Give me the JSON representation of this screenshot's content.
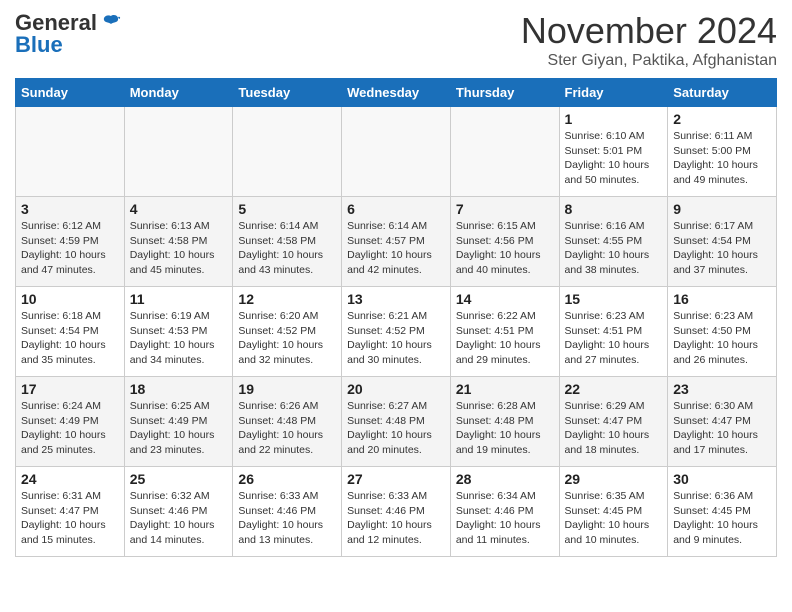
{
  "header": {
    "logo_general": "General",
    "logo_blue": "Blue",
    "month_title": "November 2024",
    "subtitle": "Ster Giyan, Paktika, Afghanistan"
  },
  "calendar": {
    "days_of_week": [
      "Sunday",
      "Monday",
      "Tuesday",
      "Wednesday",
      "Thursday",
      "Friday",
      "Saturday"
    ],
    "weeks": [
      [
        {
          "day": "",
          "info": ""
        },
        {
          "day": "",
          "info": ""
        },
        {
          "day": "",
          "info": ""
        },
        {
          "day": "",
          "info": ""
        },
        {
          "day": "",
          "info": ""
        },
        {
          "day": "1",
          "info": "Sunrise: 6:10 AM\nSunset: 5:01 PM\nDaylight: 10 hours\nand 50 minutes."
        },
        {
          "day": "2",
          "info": "Sunrise: 6:11 AM\nSunset: 5:00 PM\nDaylight: 10 hours\nand 49 minutes."
        }
      ],
      [
        {
          "day": "3",
          "info": "Sunrise: 6:12 AM\nSunset: 4:59 PM\nDaylight: 10 hours\nand 47 minutes."
        },
        {
          "day": "4",
          "info": "Sunrise: 6:13 AM\nSunset: 4:58 PM\nDaylight: 10 hours\nand 45 minutes."
        },
        {
          "day": "5",
          "info": "Sunrise: 6:14 AM\nSunset: 4:58 PM\nDaylight: 10 hours\nand 43 minutes."
        },
        {
          "day": "6",
          "info": "Sunrise: 6:14 AM\nSunset: 4:57 PM\nDaylight: 10 hours\nand 42 minutes."
        },
        {
          "day": "7",
          "info": "Sunrise: 6:15 AM\nSunset: 4:56 PM\nDaylight: 10 hours\nand 40 minutes."
        },
        {
          "day": "8",
          "info": "Sunrise: 6:16 AM\nSunset: 4:55 PM\nDaylight: 10 hours\nand 38 minutes."
        },
        {
          "day": "9",
          "info": "Sunrise: 6:17 AM\nSunset: 4:54 PM\nDaylight: 10 hours\nand 37 minutes."
        }
      ],
      [
        {
          "day": "10",
          "info": "Sunrise: 6:18 AM\nSunset: 4:54 PM\nDaylight: 10 hours\nand 35 minutes."
        },
        {
          "day": "11",
          "info": "Sunrise: 6:19 AM\nSunset: 4:53 PM\nDaylight: 10 hours\nand 34 minutes."
        },
        {
          "day": "12",
          "info": "Sunrise: 6:20 AM\nSunset: 4:52 PM\nDaylight: 10 hours\nand 32 minutes."
        },
        {
          "day": "13",
          "info": "Sunrise: 6:21 AM\nSunset: 4:52 PM\nDaylight: 10 hours\nand 30 minutes."
        },
        {
          "day": "14",
          "info": "Sunrise: 6:22 AM\nSunset: 4:51 PM\nDaylight: 10 hours\nand 29 minutes."
        },
        {
          "day": "15",
          "info": "Sunrise: 6:23 AM\nSunset: 4:51 PM\nDaylight: 10 hours\nand 27 minutes."
        },
        {
          "day": "16",
          "info": "Sunrise: 6:23 AM\nSunset: 4:50 PM\nDaylight: 10 hours\nand 26 minutes."
        }
      ],
      [
        {
          "day": "17",
          "info": "Sunrise: 6:24 AM\nSunset: 4:49 PM\nDaylight: 10 hours\nand 25 minutes."
        },
        {
          "day": "18",
          "info": "Sunrise: 6:25 AM\nSunset: 4:49 PM\nDaylight: 10 hours\nand 23 minutes."
        },
        {
          "day": "19",
          "info": "Sunrise: 6:26 AM\nSunset: 4:48 PM\nDaylight: 10 hours\nand 22 minutes."
        },
        {
          "day": "20",
          "info": "Sunrise: 6:27 AM\nSunset: 4:48 PM\nDaylight: 10 hours\nand 20 minutes."
        },
        {
          "day": "21",
          "info": "Sunrise: 6:28 AM\nSunset: 4:48 PM\nDaylight: 10 hours\nand 19 minutes."
        },
        {
          "day": "22",
          "info": "Sunrise: 6:29 AM\nSunset: 4:47 PM\nDaylight: 10 hours\nand 18 minutes."
        },
        {
          "day": "23",
          "info": "Sunrise: 6:30 AM\nSunset: 4:47 PM\nDaylight: 10 hours\nand 17 minutes."
        }
      ],
      [
        {
          "day": "24",
          "info": "Sunrise: 6:31 AM\nSunset: 4:47 PM\nDaylight: 10 hours\nand 15 minutes."
        },
        {
          "day": "25",
          "info": "Sunrise: 6:32 AM\nSunset: 4:46 PM\nDaylight: 10 hours\nand 14 minutes."
        },
        {
          "day": "26",
          "info": "Sunrise: 6:33 AM\nSunset: 4:46 PM\nDaylight: 10 hours\nand 13 minutes."
        },
        {
          "day": "27",
          "info": "Sunrise: 6:33 AM\nSunset: 4:46 PM\nDaylight: 10 hours\nand 12 minutes."
        },
        {
          "day": "28",
          "info": "Sunrise: 6:34 AM\nSunset: 4:46 PM\nDaylight: 10 hours\nand 11 minutes."
        },
        {
          "day": "29",
          "info": "Sunrise: 6:35 AM\nSunset: 4:45 PM\nDaylight: 10 hours\nand 10 minutes."
        },
        {
          "day": "30",
          "info": "Sunrise: 6:36 AM\nSunset: 4:45 PM\nDaylight: 10 hours\nand 9 minutes."
        }
      ]
    ]
  }
}
